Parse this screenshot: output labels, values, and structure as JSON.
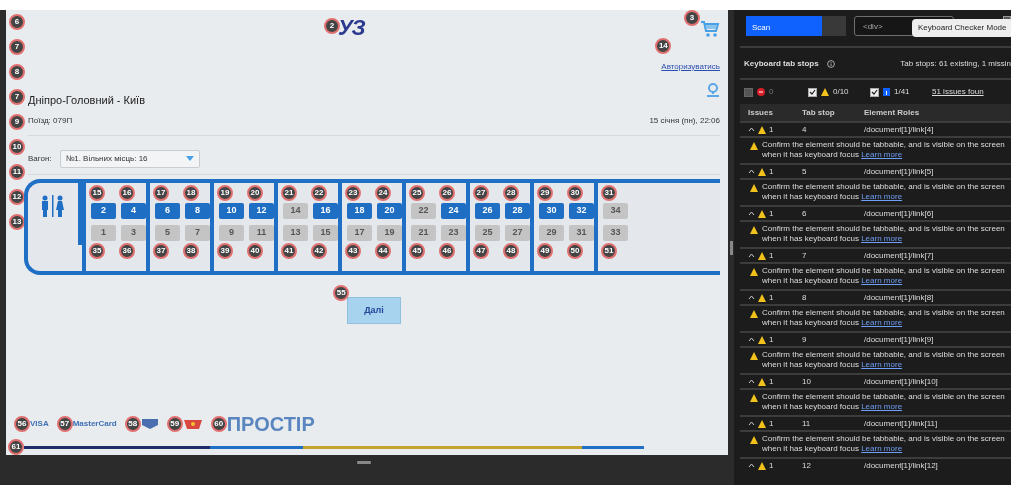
{
  "site": {
    "logo": {
      "text": "УЗ",
      "tab_stop": "2"
    },
    "cart": {
      "tab_stop": "3"
    },
    "left_markers": [
      "6",
      "7",
      "8",
      "7",
      "9",
      "10",
      "11",
      "12",
      "13"
    ],
    "login_link": {
      "text": "Авторизуватись",
      "tab_stop": "14"
    },
    "route": "Дніпро-Головний - Київ",
    "train": "Поїзд: 079П",
    "datetime": "15 січня (пн), 22:06",
    "car_label": "Вагон:",
    "car_select": "№1. Вільних місць: 16",
    "seats_upper": [
      {
        "number": "2",
        "free": true,
        "tab_stop": "15"
      },
      {
        "number": "4",
        "free": true,
        "tab_stop": "16"
      },
      {
        "number": "6",
        "free": true,
        "tab_stop": "17"
      },
      {
        "number": "8",
        "free": true,
        "tab_stop": "18"
      },
      {
        "number": "10",
        "free": true,
        "tab_stop": "19"
      },
      {
        "number": "12",
        "free": true,
        "tab_stop": "20"
      },
      {
        "number": "14",
        "free": false,
        "tab_stop": "21"
      },
      {
        "number": "16",
        "free": true,
        "tab_stop": "22"
      },
      {
        "number": "18",
        "free": true,
        "tab_stop": "23"
      },
      {
        "number": "20",
        "free": true,
        "tab_stop": "24"
      },
      {
        "number": "22",
        "free": false,
        "tab_stop": "25"
      },
      {
        "number": "24",
        "free": true,
        "tab_stop": "26"
      },
      {
        "number": "26",
        "free": true,
        "tab_stop": "27"
      },
      {
        "number": "28",
        "free": true,
        "tab_stop": "28"
      },
      {
        "number": "30",
        "free": true,
        "tab_stop": "29"
      },
      {
        "number": "32",
        "free": true,
        "tab_stop": "30"
      },
      {
        "number": "34",
        "free": false,
        "tab_stop": "31"
      }
    ],
    "seats_lower": [
      {
        "number": "1",
        "free": false,
        "tab_stop": "35"
      },
      {
        "number": "3",
        "free": false,
        "tab_stop": "36"
      },
      {
        "number": "5",
        "free": false,
        "tab_stop": "37"
      },
      {
        "number": "7",
        "free": false,
        "tab_stop": "38"
      },
      {
        "number": "9",
        "free": false,
        "tab_stop": "39"
      },
      {
        "number": "11",
        "free": false,
        "tab_stop": "40"
      },
      {
        "number": "13",
        "free": false,
        "tab_stop": "41"
      },
      {
        "number": "15",
        "free": false,
        "tab_stop": "42"
      },
      {
        "number": "17",
        "free": false,
        "tab_stop": "43"
      },
      {
        "number": "19",
        "free": false,
        "tab_stop": "44"
      },
      {
        "number": "21",
        "free": false,
        "tab_stop": "45"
      },
      {
        "number": "23",
        "free": false,
        "tab_stop": "46"
      },
      {
        "number": "25",
        "free": false,
        "tab_stop": "47"
      },
      {
        "number": "27",
        "free": false,
        "tab_stop": "48"
      },
      {
        "number": "29",
        "free": false,
        "tab_stop": "49"
      },
      {
        "number": "31",
        "free": false,
        "tab_stop": "50"
      },
      {
        "number": "33",
        "free": false,
        "tab_stop": "51"
      }
    ],
    "next_button": {
      "label": "Далі",
      "tab_stop": "55"
    },
    "footer": [
      {
        "kind": "text",
        "text": "VISA",
        "tab_stop": "56"
      },
      {
        "kind": "text",
        "text": "MasterCard",
        "tab_stop": "57"
      },
      {
        "kind": "shield",
        "tab_stop": "58"
      },
      {
        "kind": "badge",
        "tab_stop": "59"
      },
      {
        "kind": "text",
        "text": "ПРОСТІР",
        "tab_stop": "60"
      }
    ],
    "bottom_marker": "61"
  },
  "checker": {
    "scan_button": "Scan",
    "selector_field": "<div>",
    "tooltip": "Keyboard Checker Mode",
    "title": "Keyboard tab stops",
    "summary": "Tab stops: 61 existing, 1 missin",
    "filters": [
      {
        "kind": "error",
        "checked": false,
        "text": "0"
      },
      {
        "kind": "warning",
        "checked": true,
        "text": "0/10"
      },
      {
        "kind": "info",
        "checked": true,
        "text": "1/41"
      }
    ],
    "issues_link": "51 issues foun",
    "columns": [
      "Issues",
      "Tab stop",
      "Element Roles"
    ],
    "rows": [
      {
        "expanded": true,
        "count": "1",
        "tab_stop": "4",
        "role": "/document[1]/link[4]",
        "message": "Confirm the element should be tabbable, and is visible on the screen when it has keyboard focus",
        "link": "Learn more"
      },
      {
        "expanded": true,
        "count": "1",
        "tab_stop": "5",
        "role": "/document[1]/link[5]",
        "message": "Confirm the element should be tabbable, and is visible on the screen when it has keyboard focus",
        "link": "Learn more"
      },
      {
        "expanded": true,
        "count": "1",
        "tab_stop": "6",
        "role": "/document[1]/link[6]",
        "message": "Confirm the element should be tabbable, and is visible on the screen when it has keyboard focus",
        "link": "Learn more"
      },
      {
        "expanded": true,
        "count": "1",
        "tab_stop": "7",
        "role": "/document[1]/link[7]",
        "message": "Confirm the element should be tabbable, and is visible on the screen when it has keyboard focus",
        "link": "Learn more"
      },
      {
        "expanded": true,
        "count": "1",
        "tab_stop": "8",
        "role": "/document[1]/link[8]",
        "message": "Confirm the element should be tabbable, and is visible on the screen when it has keyboard focus",
        "link": "Learn more"
      },
      {
        "expanded": true,
        "count": "1",
        "tab_stop": "9",
        "role": "/document[1]/link[9]",
        "message": "Confirm the element should be tabbable, and is visible on the screen when it has keyboard focus",
        "link": "Learn more"
      },
      {
        "expanded": true,
        "count": "1",
        "tab_stop": "10",
        "role": "/document[1]/link[10]",
        "message": "Confirm the element should be tabbable, and is visible on the screen when it has keyboard focus",
        "link": "Learn more"
      },
      {
        "expanded": true,
        "count": "1",
        "tab_stop": "11",
        "role": "/document[1]/link[11]",
        "message": "Confirm the element should be tabbable, and is visible on the screen when it has keyboard focus",
        "link": "Learn more"
      },
      {
        "expanded": true,
        "count": "1",
        "tab_stop": "12",
        "role": "/document[1]/link[12]"
      }
    ]
  }
}
